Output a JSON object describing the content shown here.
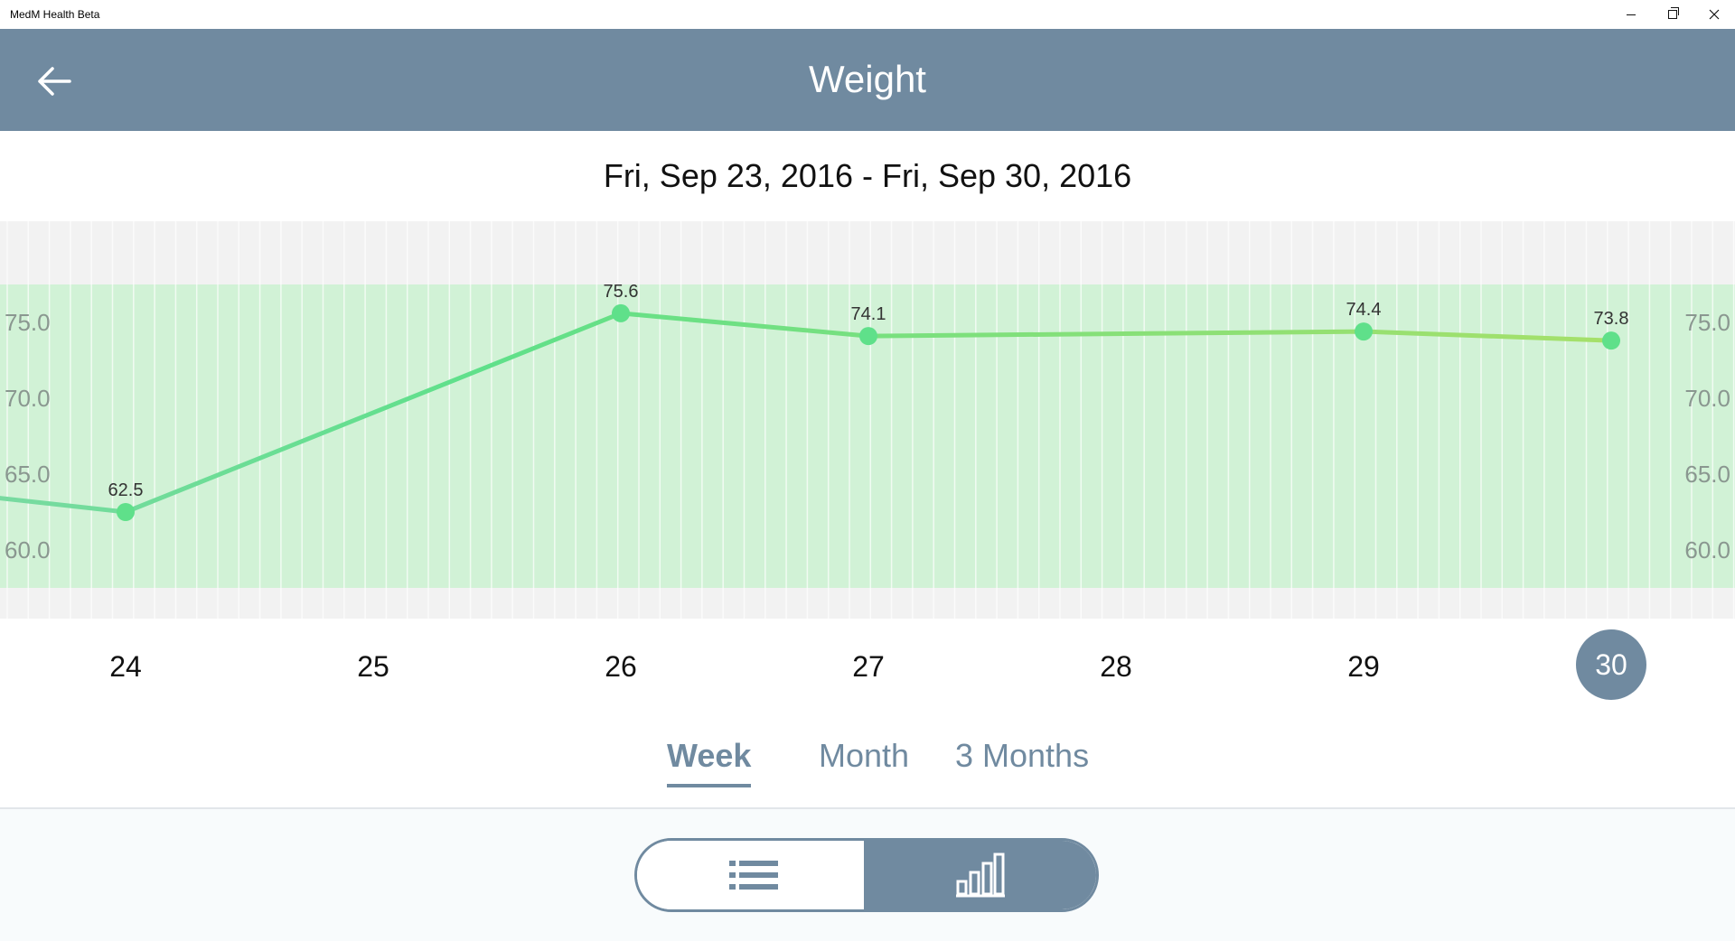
{
  "window": {
    "app_title": "MedM Health Beta"
  },
  "header": {
    "title": "Weight",
    "back_icon": "arrow-left-icon"
  },
  "date_range": "Fri, Sep 23, 2016 - Fri, Sep 30, 2016",
  "chart_data": {
    "type": "line",
    "x": [
      "23",
      "24",
      "26",
      "27",
      "29",
      "30"
    ],
    "values": [
      64.3,
      62.5,
      75.6,
      74.1,
      74.4,
      73.8
    ],
    "point_labels": [
      "",
      "62.5",
      "75.6",
      "74.1",
      "74.4",
      "73.8"
    ],
    "y_ticks": [
      "60.0",
      "65.0",
      "70.0",
      "75.0"
    ],
    "ylim": [
      57.5,
      77.6
    ],
    "normal_range_band": true,
    "line_colors": [
      "#7ed9a6",
      "#5fe08a",
      "#a6e06a"
    ],
    "band_color": "#d1f2d6"
  },
  "days": [
    {
      "label": "24",
      "selected": false
    },
    {
      "label": "25",
      "selected": false
    },
    {
      "label": "26",
      "selected": false
    },
    {
      "label": "27",
      "selected": false
    },
    {
      "label": "28",
      "selected": false
    },
    {
      "label": "29",
      "selected": false
    },
    {
      "label": "30",
      "selected": true
    }
  ],
  "period_tabs": {
    "week": "Week",
    "month": "Month",
    "three_months": "3 Months",
    "active": "week"
  },
  "view_toggle": {
    "list_icon": "list-icon",
    "chart_icon": "bar-chart-icon",
    "active": "chart"
  },
  "colors": {
    "accent": "#708aa0",
    "band": "#d1f2d6",
    "line_start": "#7ed9a6",
    "line_end": "#a6e06a",
    "point": "#5fe08a"
  }
}
